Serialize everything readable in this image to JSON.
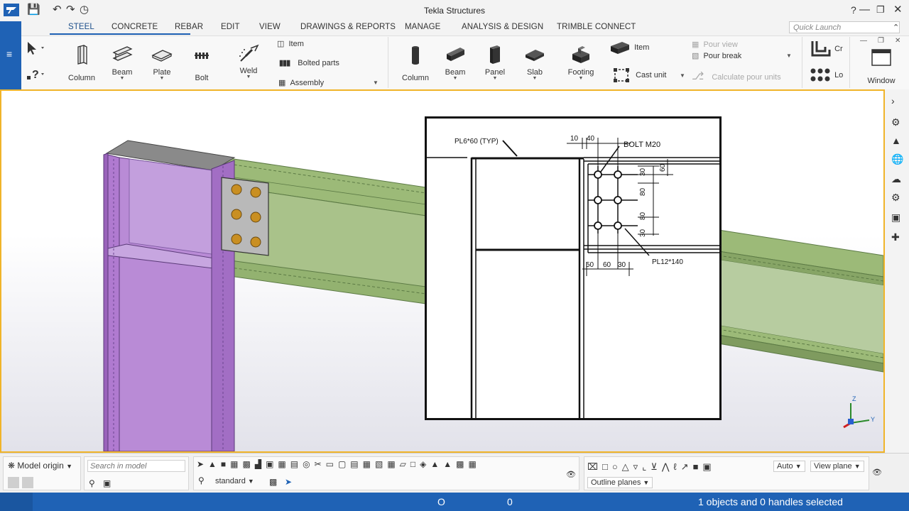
{
  "app": {
    "title": "Tekla Structures"
  },
  "tabs": [
    "STEEL",
    "CONCRETE",
    "REBAR",
    "EDIT",
    "VIEW",
    "DRAWINGS & REPORTS",
    "MANAGE",
    "ANALYSIS & DESIGN",
    "TRIMBLE CONNECT"
  ],
  "quick_launch": {
    "placeholder": "Quick Launch"
  },
  "steel_tools": {
    "column": "Column",
    "beam": "Beam",
    "plate": "Plate",
    "bolt": "Bolt",
    "weld": "Weld",
    "item": "Item",
    "bolted_parts": "Bolted parts",
    "assembly": "Assembly"
  },
  "concrete_tools": {
    "column": "Column",
    "beam": "Beam",
    "panel": "Panel",
    "slab": "Slab",
    "footing": "Footing",
    "item": "Item",
    "cast_unit": "Cast unit",
    "pour_view": "Pour view",
    "pour_break": "Pour break",
    "calculate_pour_units": "Calculate pour units"
  },
  "rebar_short": {
    "cr": "Cr",
    "lo": "Lo"
  },
  "window_tool": "Window",
  "drawing": {
    "pl_typ": "PL6*60 (TYP)",
    "dim_10": "10",
    "dim_40": "40",
    "bolt": "BOLT M20",
    "dim_30a": "30",
    "dim_60v": "60",
    "dim_80a": "80",
    "dim_80b": "80",
    "dim_30b": "30",
    "dim_50": "50",
    "dim_60h": "60",
    "dim_30c": "30",
    "pl12": "PL12*140"
  },
  "axes": {
    "z": "Z",
    "y": "Y"
  },
  "bottom": {
    "model_origin": "Model origin",
    "search_placeholder": "Search in model",
    "standard": "standard",
    "auto": "Auto",
    "view_plane": "View plane",
    "outline_planes": "Outline planes"
  },
  "status": {
    "o_label": "O",
    "zero": "0",
    "selection": "1 objects and 0 handles selected"
  },
  "colors": {
    "accent": "#1f62b5",
    "column": "#b07ad0",
    "beam": "#9cba78",
    "viewport_border": "#f0b429"
  }
}
